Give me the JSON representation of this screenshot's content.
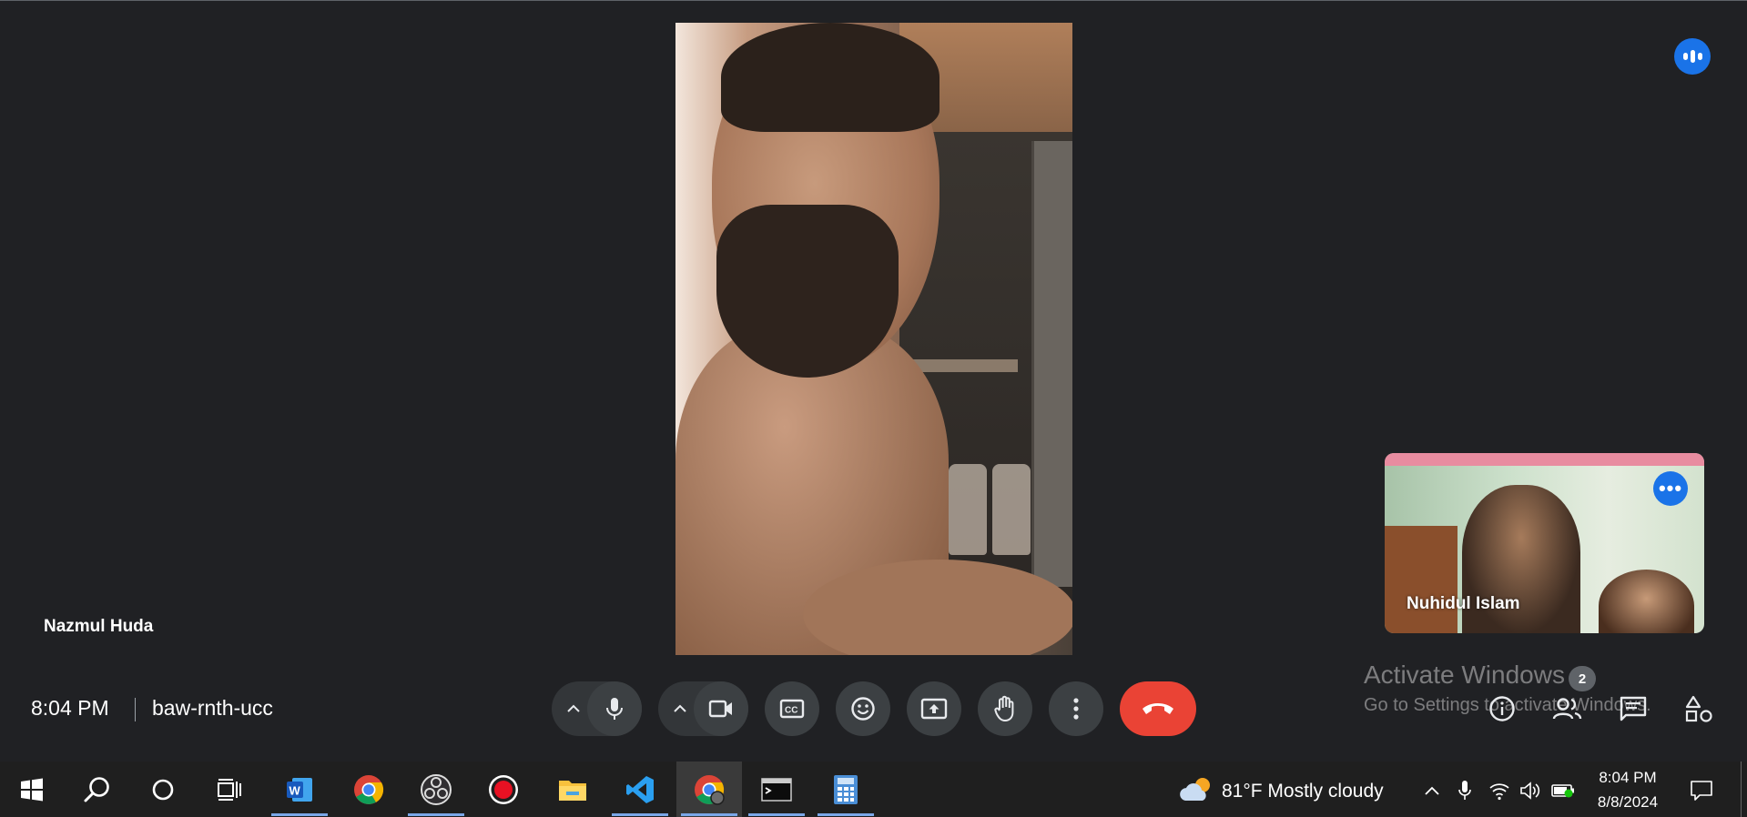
{
  "meeting": {
    "time": "8:04 PM",
    "code": "baw-rnth-ucc",
    "main_participant": "Nazmul Huda",
    "self_participant": "Nuhidul Islam",
    "participant_count": "2"
  },
  "watermark": {
    "title": "Activate Windows",
    "subtitle": "Go to Settings to activate Windows."
  },
  "controls": [
    {
      "name": "microphone",
      "icon": "mic-icon"
    },
    {
      "name": "camera",
      "icon": "video-camera-icon"
    },
    {
      "name": "captions",
      "icon": "closed-caption-icon"
    },
    {
      "name": "reactions",
      "icon": "emoji-icon"
    },
    {
      "name": "present",
      "icon": "present-screen-icon"
    },
    {
      "name": "raise-hand",
      "icon": "hand-icon"
    },
    {
      "name": "more-options",
      "icon": "more-vert-icon"
    },
    {
      "name": "leave-call",
      "icon": "hang-up-icon"
    }
  ],
  "side_panel": [
    "info-icon",
    "people-icon",
    "chat-icon",
    "activities-icon"
  ],
  "taskbar": {
    "weather": "81°F  Mostly cloudy",
    "clock_time": "8:04 PM",
    "clock_date": "8/8/2024",
    "apps": [
      "start-icon",
      "search-icon",
      "cortana-icon",
      "task-view-icon",
      "word-icon",
      "chrome-icon",
      "obs-icon",
      "record-icon",
      "file-explorer-icon",
      "vscode-icon",
      "chrome-profile-icon",
      "terminal-icon",
      "calculator-icon"
    ]
  },
  "colors": {
    "background": "#202124",
    "accent_blue": "#1a73e8",
    "hangup_red": "#ea4335",
    "control_gray": "#3c4043"
  }
}
